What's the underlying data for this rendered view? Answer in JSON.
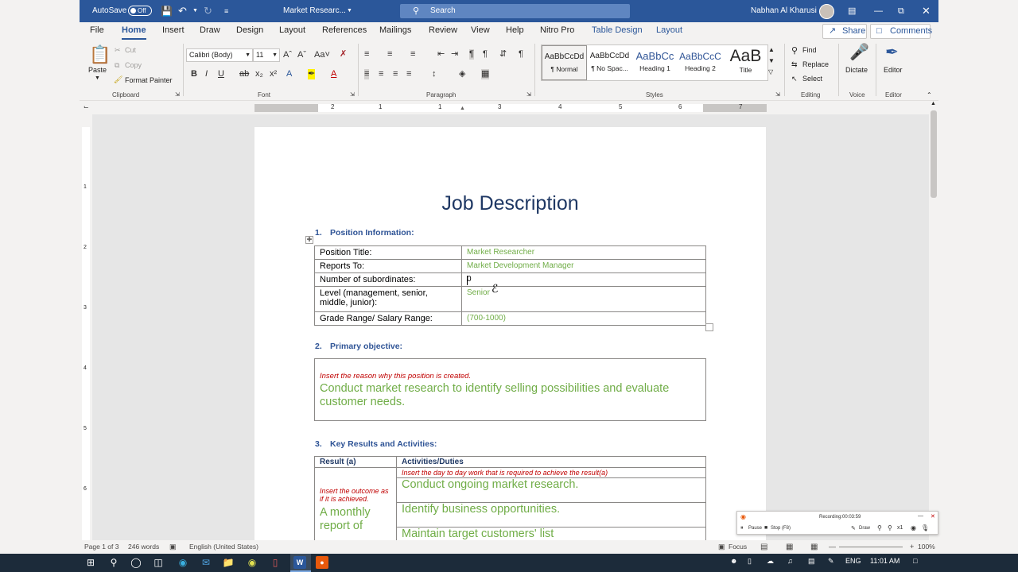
{
  "titlebar": {
    "autosave_label": "AutoSave",
    "autosave_state": "Off",
    "doc_name": "Market Researc...",
    "search_placeholder": "Search",
    "user_name": "Nabhan Al Kharusi"
  },
  "menu": {
    "tabs": [
      "File",
      "Home",
      "Insert",
      "Draw",
      "Design",
      "Layout",
      "References",
      "Mailings",
      "Review",
      "View",
      "Help",
      "Nitro Pro",
      "Table Design",
      "Layout"
    ],
    "active_tab": "Home",
    "share_label": "Share",
    "comments_label": "Comments"
  },
  "ribbon": {
    "clipboard": {
      "paste": "Paste",
      "cut": "Cut",
      "copy": "Copy",
      "format_painter": "Format Painter",
      "group": "Clipboard"
    },
    "font": {
      "name": "Calibri (Body)",
      "size": "11",
      "group": "Font"
    },
    "paragraph": {
      "group": "Paragraph"
    },
    "styles": {
      "group": "Styles",
      "items": [
        {
          "preview": "AaBbCcDd",
          "name": "¶ Normal"
        },
        {
          "preview": "AaBbCcDd",
          "name": "¶ No Spac..."
        },
        {
          "preview": "AaBbCc",
          "name": "Heading 1"
        },
        {
          "preview": "AaBbCcC",
          "name": "Heading 2"
        },
        {
          "preview": "AaB",
          "name": "Title"
        }
      ]
    },
    "editing": {
      "find": "Find",
      "replace": "Replace",
      "select": "Select",
      "group": "Editing"
    },
    "voice": {
      "dictate": "Dictate",
      "group": "Voice"
    },
    "editor": {
      "label": "Editor",
      "group": "Editor"
    }
  },
  "ruler": {
    "numbers": [
      "2",
      "1",
      "1",
      "2",
      "3",
      "4",
      "5",
      "6",
      "7"
    ]
  },
  "vruler": {
    "numbers": [
      "1",
      "2",
      "3",
      "4",
      "5",
      "6"
    ]
  },
  "document": {
    "title": "Job Description",
    "section1": {
      "heading_num": "1.",
      "heading": "Position Information:",
      "rows": [
        {
          "label": "Position Title:",
          "value": "Market Researcher"
        },
        {
          "label": "Reports To:",
          "value": "Market Development Manager"
        },
        {
          "label": "Number of subordinates:",
          "value": "0"
        },
        {
          "label": "Level (management, senior, middle, junior):",
          "value": "Senior"
        },
        {
          "label": "Grade Range/ Salary Range:",
          "value": "(700-1000)"
        }
      ]
    },
    "section2": {
      "heading_num": "2.",
      "heading": "Primary objective:",
      "hint": "Insert the reason why this position is created.",
      "text": "Conduct market research to identify selling possibilities and evaluate customer needs."
    },
    "section3": {
      "heading_num": "3.",
      "heading": "Key Results and Activities:",
      "col_result": "Result (a)",
      "col_activities": "Activities/Duties",
      "activities_hint": "Insert the day to day work that is required to achieve the result(a)",
      "result_hint": "Insert the outcome as if it is achieved.",
      "result_text": "A monthly report of",
      "activities": [
        "Conduct ongoing market research.",
        "Identify business opportunities.",
        "Maintain target customers' list"
      ]
    }
  },
  "recorder": {
    "label": "Recording:",
    "time": "00:03:59",
    "pause": "Pause",
    "stop": "Stop (F8)",
    "draw": "Draw",
    "zoom": "x1"
  },
  "statusbar": {
    "page": "Page 1 of 3",
    "words": "246 words",
    "language": "English (United States)",
    "focus": "Focus",
    "zoom": "100%"
  },
  "taskbar": {
    "lang": "ENG",
    "time": "11:01 AM"
  },
  "colors": {
    "word_blue": "#2b579a",
    "heading_blue": "#2f5496",
    "title_navy": "#1f3864",
    "field_green": "#70ad47",
    "hint_red": "#c00000"
  }
}
